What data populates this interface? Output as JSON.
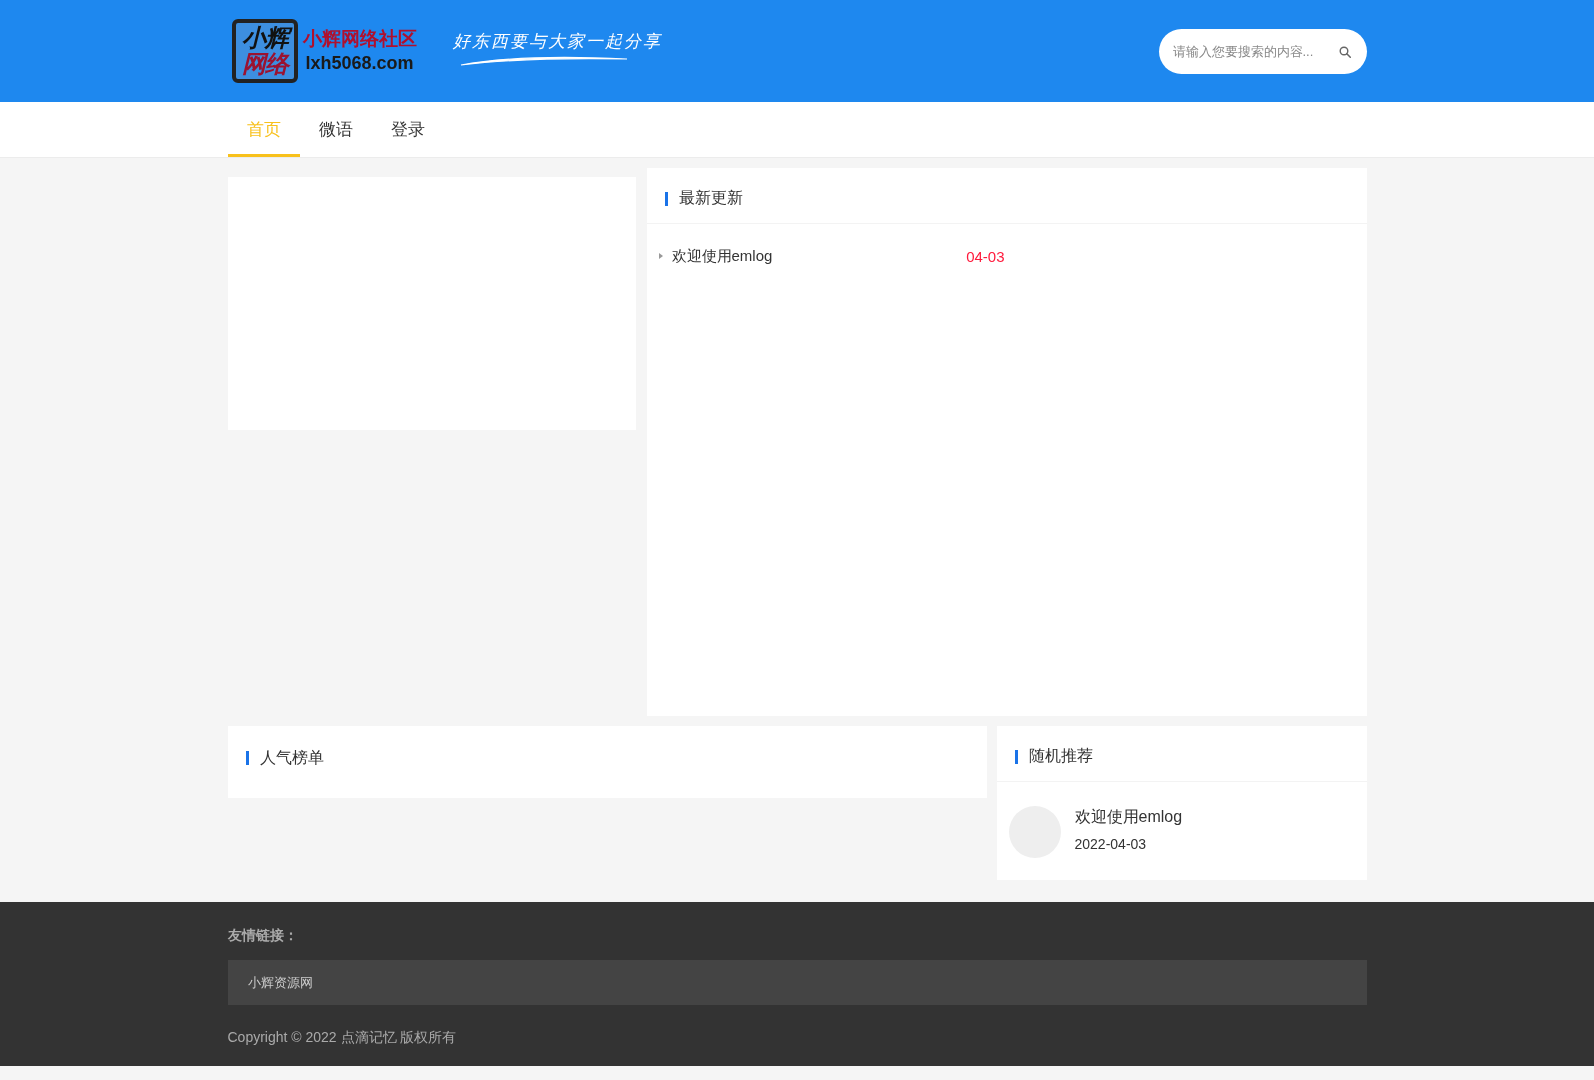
{
  "header": {
    "logo": {
      "mark_lines": [
        "小辉",
        "网络"
      ],
      "title": "小辉网络社区",
      "domain": "lxh5068.com"
    },
    "slogan": "好东西要与大家一起分享",
    "search": {
      "placeholder": "请输入您要搜索的内容..."
    }
  },
  "nav": [
    {
      "label": "首页",
      "selected": true
    },
    {
      "label": "微语",
      "selected": false
    },
    {
      "label": "登录",
      "selected": false
    }
  ],
  "latest_updates": {
    "title": "最新更新",
    "items": [
      {
        "title": "欢迎使用emlog",
        "date": "04-03"
      }
    ]
  },
  "popular": {
    "title": "人气榜单"
  },
  "random_picks": {
    "title": "随机推荐",
    "items": [
      {
        "title": "欢迎使用emlog",
        "date": "2022-04-03"
      }
    ]
  },
  "footer": {
    "links_label": "友情链接：",
    "links": [
      "小辉资源网"
    ],
    "copyright": "Copyright © 2022 点滴记忆 版权所有"
  }
}
